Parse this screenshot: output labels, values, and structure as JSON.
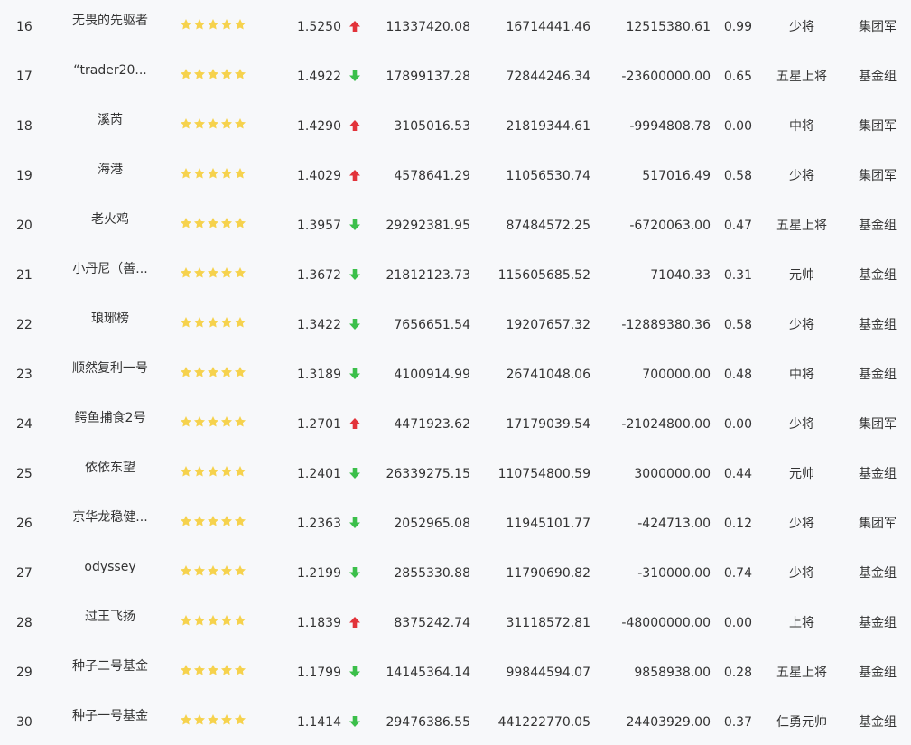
{
  "colors": {
    "star": "#f6d24d",
    "up": "#e2333a",
    "down": "#3bbf4a",
    "text": "#333333",
    "background": "#f7f8fa"
  },
  "rows": [
    {
      "rank": "16",
      "name": "无畏的先驱者",
      "stars": 5,
      "ratio": "1.5250",
      "trend": "up",
      "v1": "11337420.08",
      "v2": "16714441.46",
      "v3": "12515380.61",
      "r2": "0.99",
      "title": "少将",
      "group": "集团军"
    },
    {
      "rank": "17",
      "name": "“trader20...",
      "stars": 5,
      "ratio": "1.4922",
      "trend": "down",
      "v1": "17899137.28",
      "v2": "72844246.34",
      "v3": "-23600000.00",
      "r2": "0.65",
      "title": "五星上将",
      "group": "基金组"
    },
    {
      "rank": "18",
      "name": "溪芮",
      "stars": 5,
      "ratio": "1.4290",
      "trend": "up",
      "v1": "3105016.53",
      "v2": "21819344.61",
      "v3": "-9994808.78",
      "r2": "0.00",
      "title": "中将",
      "group": "集团军"
    },
    {
      "rank": "19",
      "name": "海港",
      "stars": 5,
      "ratio": "1.4029",
      "trend": "up",
      "v1": "4578641.29",
      "v2": "11056530.74",
      "v3": "517016.49",
      "r2": "0.58",
      "title": "少将",
      "group": "集团军"
    },
    {
      "rank": "20",
      "name": "老火鸡",
      "stars": 5,
      "ratio": "1.3957",
      "trend": "down",
      "v1": "29292381.95",
      "v2": "87484572.25",
      "v3": "-6720063.00",
      "r2": "0.47",
      "title": "五星上将",
      "group": "基金组"
    },
    {
      "rank": "21",
      "name": "小丹尼（善...",
      "stars": 5,
      "ratio": "1.3672",
      "trend": "down",
      "v1": "21812123.73",
      "v2": "115605685.52",
      "v3": "71040.33",
      "r2": "0.31",
      "title": "元帅",
      "group": "基金组"
    },
    {
      "rank": "22",
      "name": "琅琊榜",
      "stars": 5,
      "ratio": "1.3422",
      "trend": "down",
      "v1": "7656651.54",
      "v2": "19207657.32",
      "v3": "-12889380.36",
      "r2": "0.58",
      "title": "少将",
      "group": "基金组"
    },
    {
      "rank": "23",
      "name": "顺然复利一号",
      "stars": 5,
      "ratio": "1.3189",
      "trend": "down",
      "v1": "4100914.99",
      "v2": "26741048.06",
      "v3": "700000.00",
      "r2": "0.48",
      "title": "中将",
      "group": "基金组"
    },
    {
      "rank": "24",
      "name": "鳄鱼捕食2号",
      "stars": 5,
      "ratio": "1.2701",
      "trend": "up",
      "v1": "4471923.62",
      "v2": "17179039.54",
      "v3": "-21024800.00",
      "r2": "0.00",
      "title": "少将",
      "group": "集团军"
    },
    {
      "rank": "25",
      "name": "依依东望",
      "stars": 5,
      "ratio": "1.2401",
      "trend": "down",
      "v1": "26339275.15",
      "v2": "110754800.59",
      "v3": "3000000.00",
      "r2": "0.44",
      "title": "元帅",
      "group": "基金组"
    },
    {
      "rank": "26",
      "name": "京华龙稳健...",
      "stars": 5,
      "ratio": "1.2363",
      "trend": "down",
      "v1": "2052965.08",
      "v2": "11945101.77",
      "v3": "-424713.00",
      "r2": "0.12",
      "title": "少将",
      "group": "集团军"
    },
    {
      "rank": "27",
      "name": "odyssey",
      "stars": 5,
      "ratio": "1.2199",
      "trend": "down",
      "v1": "2855330.88",
      "v2": "11790690.82",
      "v3": "-310000.00",
      "r2": "0.74",
      "title": "少将",
      "group": "基金组"
    },
    {
      "rank": "28",
      "name": "过王飞扬",
      "stars": 5,
      "ratio": "1.1839",
      "trend": "up",
      "v1": "8375242.74",
      "v2": "31118572.81",
      "v3": "-48000000.00",
      "r2": "0.00",
      "title": "上将",
      "group": "基金组"
    },
    {
      "rank": "29",
      "name": "种子二号基金",
      "stars": 5,
      "ratio": "1.1799",
      "trend": "down",
      "v1": "14145364.14",
      "v2": "99844594.07",
      "v3": "9858938.00",
      "r2": "0.28",
      "title": "五星上将",
      "group": "基金组"
    },
    {
      "rank": "30",
      "name": "种子一号基金",
      "stars": 5,
      "ratio": "1.1414",
      "trend": "down",
      "v1": "29476386.55",
      "v2": "441222770.05",
      "v3": "24403929.00",
      "r2": "0.37",
      "title": "仁勇元帅",
      "group": "基金组"
    }
  ]
}
